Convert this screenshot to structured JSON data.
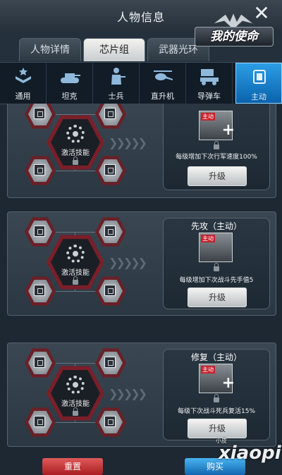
{
  "header": {
    "title": "人物信息",
    "close_icon": "close-icon"
  },
  "emblem": {
    "text": "我的使命"
  },
  "tabs": [
    {
      "label": "人物详情",
      "active": false
    },
    {
      "label": "芯片组",
      "active": true
    },
    {
      "label": "武器光环",
      "active": false
    }
  ],
  "categories": [
    {
      "label": "通用",
      "icon": "rank-insignia-icon",
      "active": false
    },
    {
      "label": "坦克",
      "icon": "tank-icon",
      "active": false
    },
    {
      "label": "士兵",
      "icon": "soldier-icon",
      "active": false
    },
    {
      "label": "直升机",
      "icon": "helicopter-icon",
      "active": false
    },
    {
      "label": "导弹车",
      "icon": "missile-truck-icon",
      "active": false
    },
    {
      "label": "主动",
      "icon": "chip-icon",
      "active": true
    }
  ],
  "panels": [
    {
      "activate_label": "激活技能",
      "skill_name": "",
      "skill_tag": "主动",
      "description": "每级增加下次行军速度100%",
      "upgrade_label": "升级"
    },
    {
      "activate_label": "激活技能",
      "skill_name": "先攻（主动）",
      "skill_tag": "主动",
      "description": "每级增加下次战斗先手值5",
      "upgrade_label": "升级"
    },
    {
      "activate_label": "激活技能",
      "skill_name": "修复（主动）",
      "skill_tag": "主动",
      "description": "每级下次战斗死兵复活15%",
      "upgrade_label": "升级"
    }
  ],
  "bottom": {
    "left_label": "重置",
    "right_label": "购买"
  },
  "watermark": {
    "text": "xiaopi",
    "small": "小皮"
  },
  "colors": {
    "accent": "#1f8fdc",
    "red": "#7a1f29",
    "panel": "#33404b"
  }
}
